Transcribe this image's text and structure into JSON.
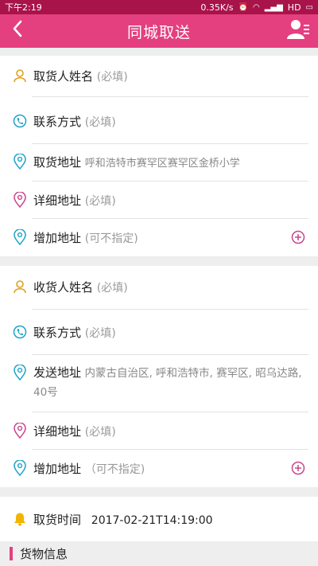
{
  "status_bar": {
    "time": "下午2:19",
    "net_speed": "0.35K/s",
    "network": "HD"
  },
  "app_bar": {
    "title": "同城取送",
    "back_icon": "chevron-left-icon",
    "profile_icon": "user-list-icon"
  },
  "pickup": {
    "name_label": "取货人姓名",
    "name_hint": "(必填)",
    "contact_label": "联系方式",
    "contact_hint": "(必填)",
    "address_label": "取货地址",
    "address_value": "呼和浩特市赛罕区赛罕区金桥小学",
    "detail_label": "详细地址",
    "detail_hint": "(必填)",
    "add_label": "增加地址",
    "add_hint": "(可不指定)"
  },
  "delivery": {
    "name_label": "收货人姓名",
    "name_hint": "(必填)",
    "contact_label": "联系方式",
    "contact_hint": "(必填)",
    "address_label": "发送地址",
    "address_value": "内蒙古自治区, 呼和浩特市, 赛罕区, 昭乌达路, 40号",
    "detail_label": "详细地址",
    "detail_hint": "(必填)",
    "add_label": "增加地址",
    "add_hint": "（可不指定)"
  },
  "pickup_time": {
    "label": "取货时间",
    "value": "2017-02-21T14:19:00"
  },
  "goods_section": {
    "title": "货物信息"
  },
  "colors": {
    "accent": "#e43f7f",
    "status_bar": "#a8134a",
    "user_icon": "#e0a020",
    "phone_icon": "#1fa3c8",
    "location_icon": "#1fa3c8",
    "detail_icon": "#c8468c",
    "bell_icon": "#f2b400"
  }
}
